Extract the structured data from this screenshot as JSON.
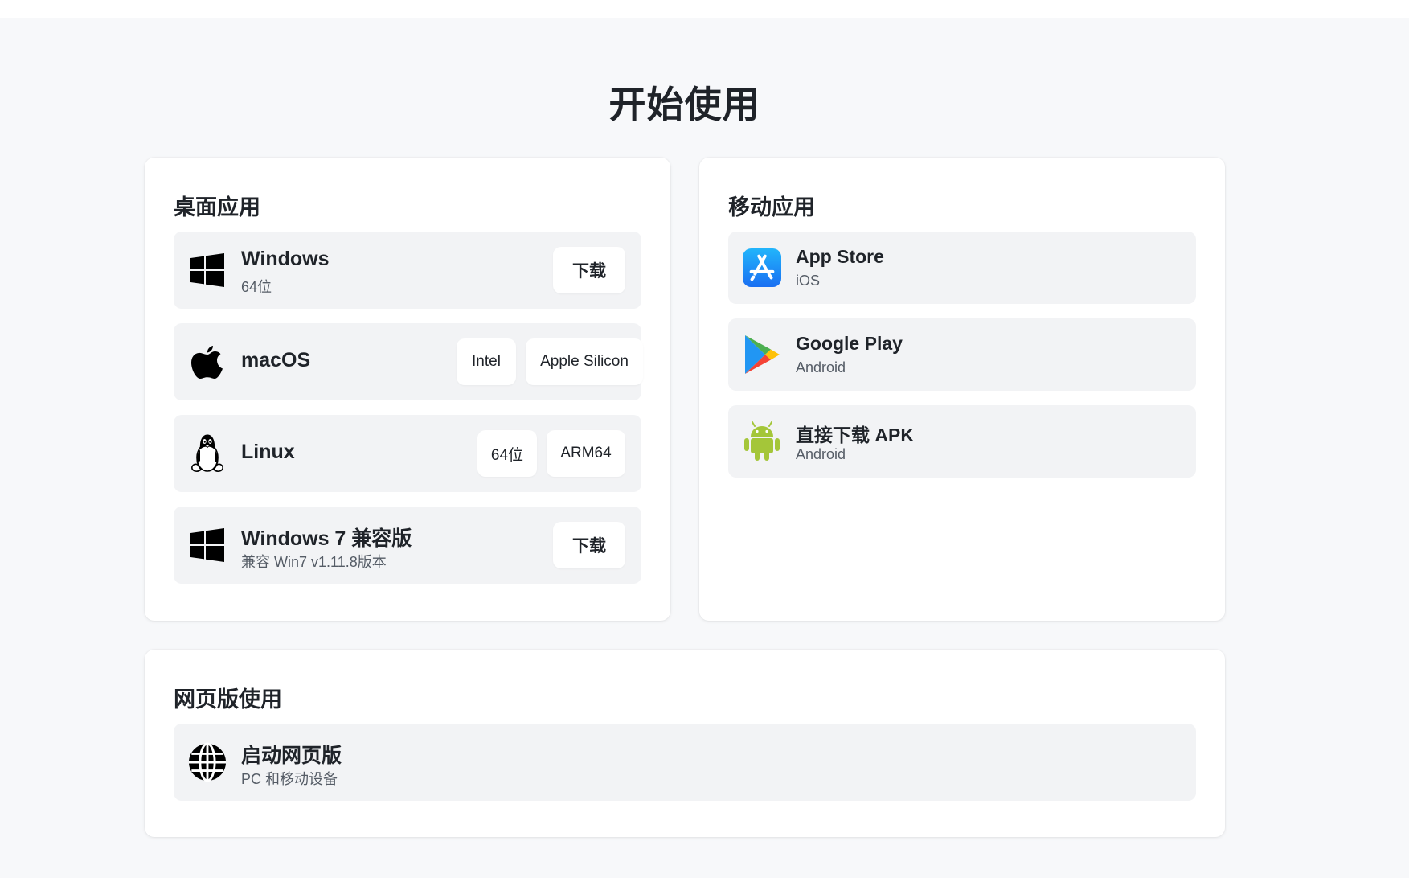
{
  "page_title": "开始使用",
  "desktop": {
    "title": "桌面应用",
    "items": [
      {
        "icon": "windows-icon",
        "name": "Windows",
        "sub": "64位",
        "buttons": [
          "下载"
        ]
      },
      {
        "icon": "apple-icon",
        "name": "macOS",
        "sub": "",
        "buttons": [
          "Intel",
          "Apple Silicon"
        ]
      },
      {
        "icon": "linux-icon",
        "name": "Linux",
        "sub": "",
        "buttons": [
          "64位",
          "ARM64"
        ]
      },
      {
        "icon": "windows-icon",
        "name": "Windows 7 兼容版",
        "sub": "兼容 Win7 v1.11.8版本",
        "buttons": [
          "下载"
        ]
      }
    ]
  },
  "mobile": {
    "title": "移动应用",
    "items": [
      {
        "icon": "app-store-icon",
        "name": "App Store",
        "sub": "iOS"
      },
      {
        "icon": "google-play-icon",
        "name": "Google Play",
        "sub": "Android"
      },
      {
        "icon": "android-icon",
        "name": "直接下载 APK",
        "sub": "Android"
      }
    ]
  },
  "web": {
    "title": "网页版使用",
    "items": [
      {
        "icon": "globe-icon",
        "name": "启动网页版",
        "sub": "PC 和移动设备"
      }
    ]
  },
  "colors": {
    "page_bg": "#f7f8fa",
    "card_bg": "#ffffff",
    "row_bg": "#f2f3f5",
    "text": "#1f2329",
    "subtext": "#555c66",
    "app_store_blue": "#1a8cff",
    "android_green": "#a4c639"
  }
}
